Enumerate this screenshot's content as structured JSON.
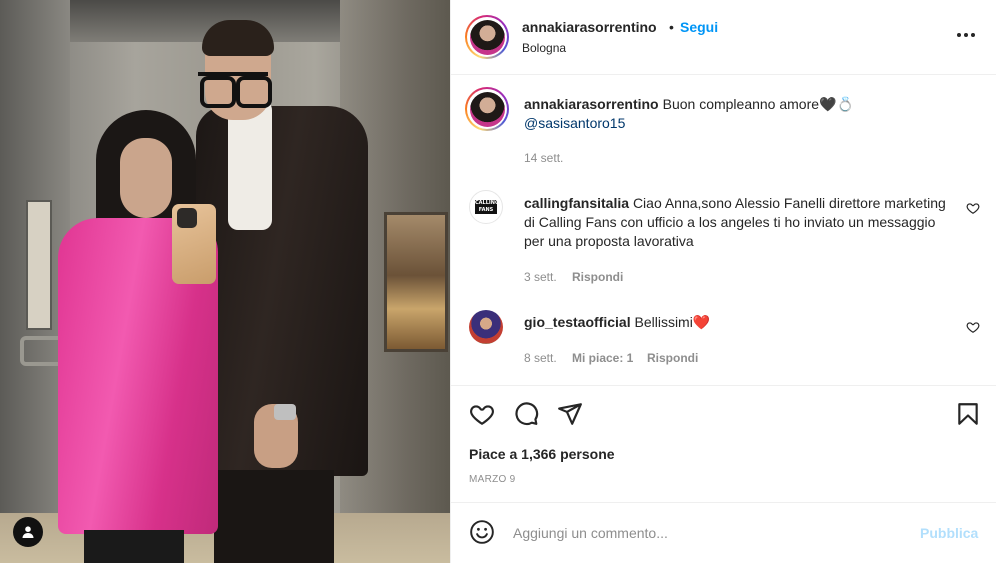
{
  "photo": {
    "alt_icon": "person-icon"
  },
  "post": {
    "author": "annakiarasorrentino",
    "dot": "•",
    "follow_label": "Segui",
    "location": "Bologna",
    "more_icon": "more-horizontal-icon"
  },
  "caption": {
    "author": "annakiarasorrentino",
    "text": "Buon compleanno amore🖤💍",
    "mention": "@sasisantoro15",
    "time": "14 sett."
  },
  "comments": [
    {
      "author": "callingfansitalia",
      "text": "Ciao Anna,sono Alessio Fanelli direttore marketing di Calling Fans con ufficio a los angeles ti ho inviato un messaggio per una proposta lavorativa",
      "time": "3 sett.",
      "reply_label": "Rispondi",
      "logo_text": "CALLING FANS"
    },
    {
      "author": "gio_testaofficial",
      "text": "Bellissimi❤️",
      "time": "8 sett.",
      "likes_label": "Mi piace: 1",
      "reply_label": "Rispondi"
    }
  ],
  "actions": {
    "like_icon": "heart-icon",
    "comment_icon": "comment-icon",
    "share_icon": "send-icon",
    "save_icon": "bookmark-icon"
  },
  "likes_text": "Piace a 1,366 persone",
  "date": "MARZO 9",
  "composer": {
    "placeholder": "Aggiungi un commento...",
    "publish_label": "Pubblica",
    "publish_color": "#b2dffc",
    "emoji_icon": "emoji-icon"
  },
  "colors": {
    "link_blue": "#0095f6",
    "mention_blue": "#00376b",
    "muted": "#8e8e8e",
    "heart_red": "#ed4956"
  }
}
